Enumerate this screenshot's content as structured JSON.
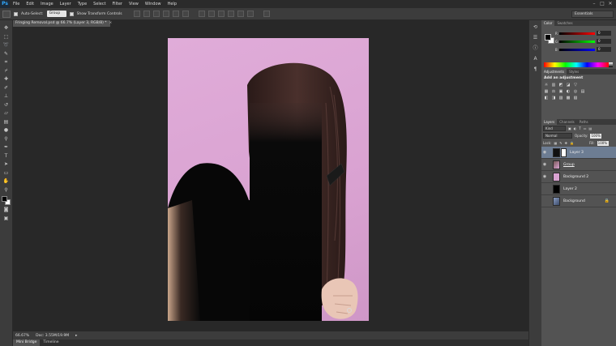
{
  "menubar": {
    "logo": "Ps",
    "items": [
      "File",
      "Edit",
      "Image",
      "Layer",
      "Type",
      "Select",
      "Filter",
      "View",
      "Window",
      "Help"
    ],
    "window_controls": [
      "–",
      "□",
      "✕"
    ]
  },
  "options_bar": {
    "auto_select_label": "Auto-Select:",
    "auto_select_value": "Group",
    "transform_label": "Show Transform Controls",
    "workspace": "Essentials"
  },
  "document": {
    "tab_title": "Fringing Removal.psd @ 66.7% (Layer 3, RGB/8) *",
    "tab_close": "×",
    "zoom": "66.67%",
    "doc_info": "Doc: 3.55M/19.9M"
  },
  "bottom_tabs": [
    "Mini Bridge",
    "Timeline"
  ],
  "color_panel": {
    "tabs": [
      "Color",
      "Swatches"
    ],
    "channels": [
      {
        "label": "R",
        "value": "0"
      },
      {
        "label": "G",
        "value": "0"
      },
      {
        "label": "B",
        "value": "0"
      }
    ],
    "colors": {
      "fg": "#000000",
      "bg": "#ffffff"
    }
  },
  "adjustments_panel": {
    "tabs": [
      "Adjustments",
      "Styles"
    ],
    "title": "Add an adjustment",
    "row1": [
      "☼",
      "▥",
      "◩",
      "◪",
      "▽"
    ],
    "row2": [
      "▦",
      "⚖",
      "▣",
      "◐",
      "◎",
      "▤"
    ],
    "row3": [
      "◧",
      "◨",
      "▨",
      "▩",
      "▧"
    ]
  },
  "layers_panel": {
    "tabs": [
      "Layers",
      "Channels",
      "Paths"
    ],
    "filter_kind": "Kind",
    "blend_mode": "Normal",
    "opacity_label": "Opacity:",
    "opacity": "100%",
    "lock_label": "Lock:",
    "fill_label": "Fill:",
    "fill": "100%",
    "layers": [
      {
        "name": "Layer 3",
        "selected": true,
        "visible": true,
        "thumb": "#111111"
      },
      {
        "name": "Group",
        "selected": false,
        "visible": true,
        "thumb": "#7a5a5a"
      },
      {
        "name": "Background 2",
        "selected": false,
        "visible": true,
        "thumb": "#d9a2d1"
      },
      {
        "name": "Layer 2",
        "selected": false,
        "visible": false,
        "thumb": "#000000"
      },
      {
        "name": "Background",
        "selected": false,
        "visible": false,
        "thumb": "#8a9cc0",
        "locked": true
      }
    ],
    "footer_icons": [
      "∞",
      "fx",
      "◐",
      "▢",
      "▭",
      "🗑"
    ]
  }
}
